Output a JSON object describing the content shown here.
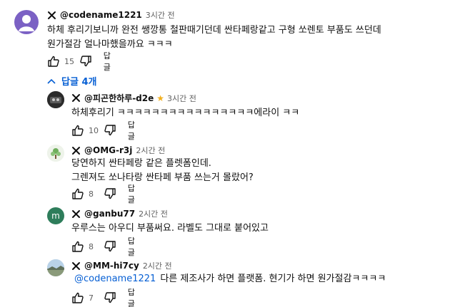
{
  "colors": {
    "link": "#065fd4",
    "muted": "#606060",
    "star": "#f2b01e",
    "avatar_purple": "#7b61c4",
    "avatar_green": "#2e7d5b"
  },
  "top_comment": {
    "author": "@codename1221",
    "time": "3시간 전",
    "lines": [
      "하체 후리기보니까 완전 쌩깡통 철판때기던데 싼타페랑같고 구형 쏘렌토 부품도 쓰던데",
      "원가절감 얼나마했을까요 ㅋㅋㅋ"
    ],
    "likes": "15",
    "reply_label": "답글"
  },
  "replies_toggle": {
    "label": "답글 4개",
    "icon": "chevron-up-icon"
  },
  "replies": [
    {
      "author": "@피곤한하루-d2e",
      "badge": "★",
      "time": "3시간 전",
      "lines": [
        "하체후리기 ㅋㅋㅋㅋㅋㅋㅋㅋㅋㅋㅋㅋㅋㅋㅋㅋ에라이 ㅋㅋ"
      ],
      "mention": "",
      "likes": "10",
      "reply_label": "답글"
    },
    {
      "author": "@OMG-r3j",
      "badge": "",
      "time": "2시간 전",
      "lines": [
        "당연하지 싼타페랑 같은 플렛폼인데.",
        "그렌져도 쏘나타랑 싼타페 부품 쓰는거 몰랐어?"
      ],
      "mention": "",
      "likes": "8",
      "reply_label": "답글"
    },
    {
      "author": "@ganbu77",
      "badge": "",
      "time": "2시간 전",
      "lines": [
        "우루스는 아우디 부품써요. 라벨도 그대로 붙어있고"
      ],
      "mention": "",
      "avatar_letter": "m",
      "likes": "8",
      "reply_label": "답글"
    },
    {
      "author": "@MM-hi7cy",
      "badge": "",
      "time": "2시간 전",
      "lines": [
        "다른 제조사가 하면 플랫폼. 현기가 하면 원가절감ㅋㅋㅋㅋ"
      ],
      "mention": "@codename1221",
      "likes": "7",
      "reply_label": "답글"
    }
  ]
}
